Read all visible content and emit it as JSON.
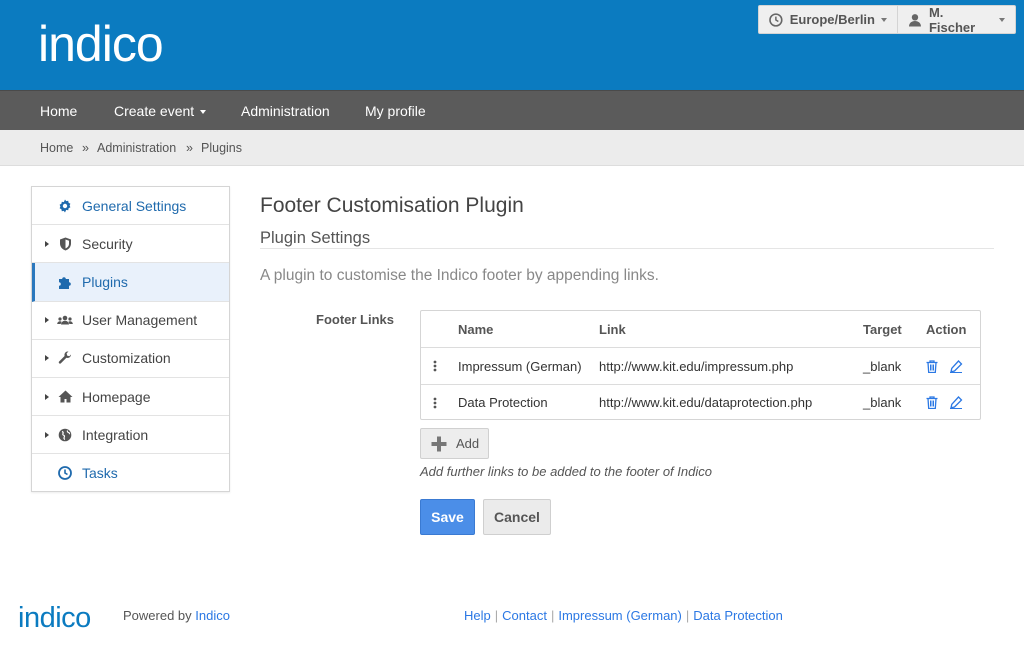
{
  "header": {
    "logo_text": "indico",
    "timezone": "Europe/Berlin",
    "user": "M. Fischer",
    "icons": {
      "timezone": "clock-icon",
      "user": "user-icon"
    }
  },
  "nav": {
    "items": [
      "Home",
      "Create event",
      "Administration",
      "My profile"
    ]
  },
  "breadcrumb": {
    "items": [
      "Home",
      "Administration",
      "Plugins"
    ],
    "separator": "»"
  },
  "sidebar": {
    "items": [
      {
        "label": "General Settings",
        "icon": "gear-icon",
        "expandable": false
      },
      {
        "label": "Security",
        "icon": "shield-icon",
        "expandable": true
      },
      {
        "label": "Plugins",
        "icon": "puzzle-icon",
        "expandable": false,
        "active": true
      },
      {
        "label": "User Management",
        "icon": "users-icon",
        "expandable": true
      },
      {
        "label": "Customization",
        "icon": "wrench-icon",
        "expandable": true
      },
      {
        "label": "Homepage",
        "icon": "home-icon",
        "expandable": true
      },
      {
        "label": "Integration",
        "icon": "globe-icon",
        "expandable": true
      },
      {
        "label": "Tasks",
        "icon": "clock-icon",
        "expandable": false
      }
    ]
  },
  "main": {
    "title": "Footer Customisation Plugin",
    "subtitle": "Plugin Settings",
    "description": "A plugin to customise the Indico footer by appending links.",
    "field_label": "Footer Links",
    "table": {
      "headers": [
        "Name",
        "Link",
        "Target",
        "Action"
      ],
      "rows": [
        {
          "name": "Impressum (German)",
          "link": "http://www.kit.edu/impressum.php",
          "target": "_blank"
        },
        {
          "name": "Data Protection",
          "link": "http://www.kit.edu/dataprotection.php",
          "target": "_blank"
        }
      ]
    },
    "add_label": "Add",
    "hint": "Add further links to be added to the footer of Indico",
    "save_label": "Save",
    "cancel_label": "Cancel"
  },
  "footer": {
    "logo_text": "indico",
    "powered_prefix": "Powered by",
    "powered_link": "Indico",
    "links": [
      "Help",
      "Contact",
      "Impressum (German)",
      "Data Protection"
    ],
    "separator": "|"
  },
  "colors": {
    "header_bg": "#0b7bc0",
    "nav_bg": "#5b5b5b",
    "accent": "#2b78bd",
    "primary_button": "#4b8ee8"
  }
}
